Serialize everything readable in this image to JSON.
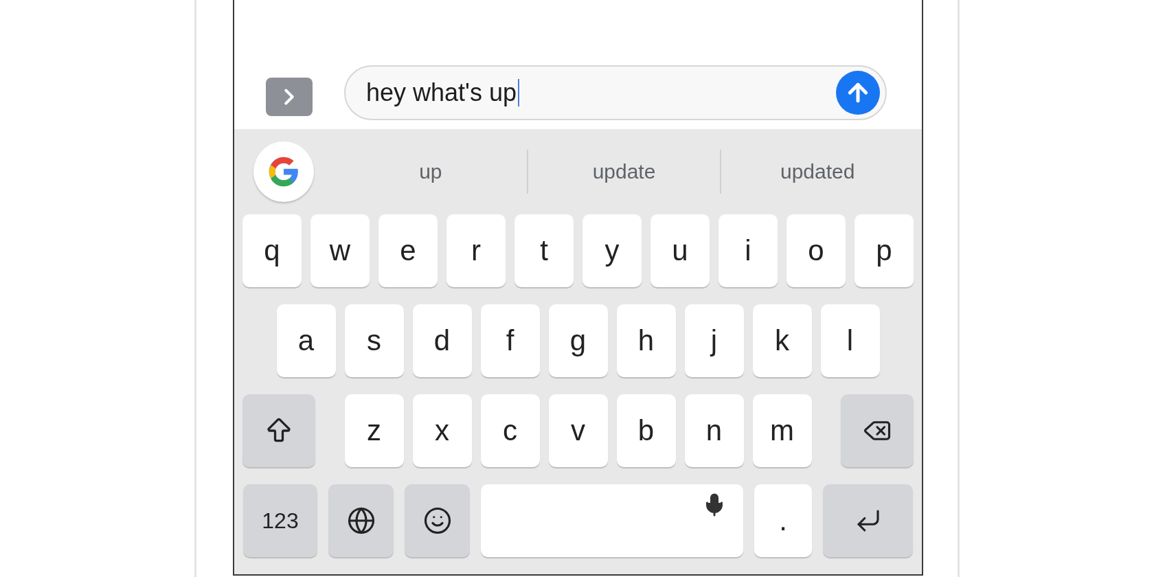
{
  "message": {
    "value": "hey what's up"
  },
  "suggestions": [
    {
      "label": "up"
    },
    {
      "label": "update"
    },
    {
      "label": "updated"
    }
  ],
  "keyboard": {
    "rows": [
      {
        "keys": [
          {
            "kind": "letter",
            "label": "q"
          },
          {
            "kind": "letter",
            "label": "w"
          },
          {
            "kind": "letter",
            "label": "e"
          },
          {
            "kind": "letter",
            "label": "r"
          },
          {
            "kind": "letter",
            "label": "t"
          },
          {
            "kind": "letter",
            "label": "y"
          },
          {
            "kind": "letter",
            "label": "u"
          },
          {
            "kind": "letter",
            "label": "i"
          },
          {
            "kind": "letter",
            "label": "o"
          },
          {
            "kind": "letter",
            "label": "p"
          }
        ]
      },
      {
        "keys": [
          {
            "kind": "letter",
            "label": "a"
          },
          {
            "kind": "letter",
            "label": "s"
          },
          {
            "kind": "letter",
            "label": "d"
          },
          {
            "kind": "letter",
            "label": "f"
          },
          {
            "kind": "letter",
            "label": "g"
          },
          {
            "kind": "letter",
            "label": "h"
          },
          {
            "kind": "letter",
            "label": "j"
          },
          {
            "kind": "letter",
            "label": "k"
          },
          {
            "kind": "letter",
            "label": "l"
          }
        ]
      },
      {
        "keys": [
          {
            "kind": "shift"
          },
          {
            "kind": "letter",
            "label": "z"
          },
          {
            "kind": "letter",
            "label": "x"
          },
          {
            "kind": "letter",
            "label": "c"
          },
          {
            "kind": "letter",
            "label": "v"
          },
          {
            "kind": "letter",
            "label": "b"
          },
          {
            "kind": "letter",
            "label": "n"
          },
          {
            "kind": "letter",
            "label": "m"
          },
          {
            "kind": "backspace"
          }
        ]
      },
      {
        "keys": [
          {
            "kind": "numbers",
            "label": "123"
          },
          {
            "kind": "globe"
          },
          {
            "kind": "emoji"
          },
          {
            "kind": "space"
          },
          {
            "kind": "period",
            "label": "."
          },
          {
            "kind": "return"
          }
        ]
      }
    ]
  }
}
